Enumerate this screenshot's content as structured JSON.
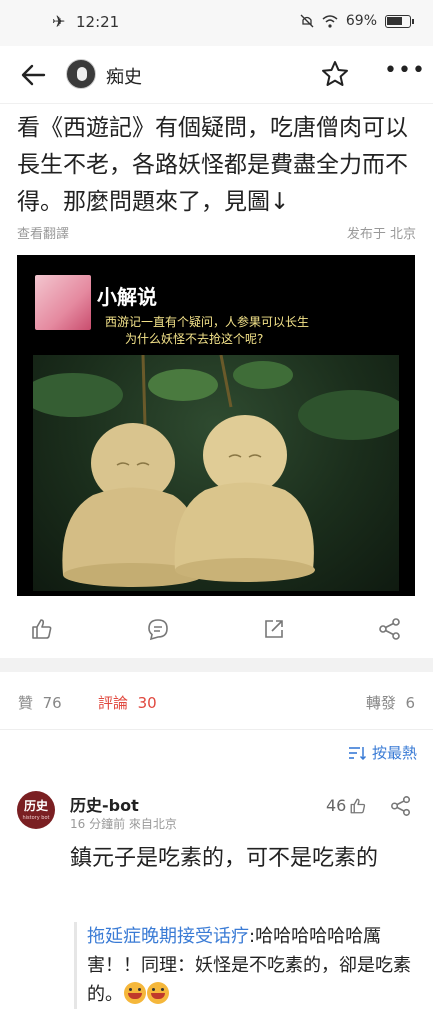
{
  "status_bar": {
    "time": "12:21",
    "battery": "69%"
  },
  "header": {
    "account_name": "痴史"
  },
  "post": {
    "text": "看《西遊記》有個疑問，吃唐僧肉可以長生不老，各路妖怪都是費盡全力而不得。那麼問題來了，見圖↓",
    "translate_label": "查看翻譯",
    "location": "发布于 北京"
  },
  "image": {
    "title": "小解说",
    "caption_line1": "西游记一直有个疑问，人参果可以长生",
    "caption_line2": "为什么妖怪不去抢这个呢?"
  },
  "tabs": {
    "likes_label": "贊",
    "likes_count": "76",
    "comments_label": "評論",
    "comments_count": "30",
    "reposts_label": "轉發",
    "reposts_count": "6"
  },
  "sort_label": "按最熱",
  "comment": {
    "avatar_text": "历史",
    "avatar_subtext": "history bot",
    "author": "历史-bot",
    "meta": "16 分鐘前  來自北京",
    "likes": "46",
    "text": "鎮元子是吃素的，可不是吃素的",
    "reply_author": "拖延症晚期接受话疗",
    "reply_text": ":哈哈哈哈哈哈厲害！！同理：妖怪是不吃素的，卻是吃素的。"
  },
  "colors": {
    "accent_red": "#e0483e",
    "link_blue": "#3a7bd5"
  }
}
